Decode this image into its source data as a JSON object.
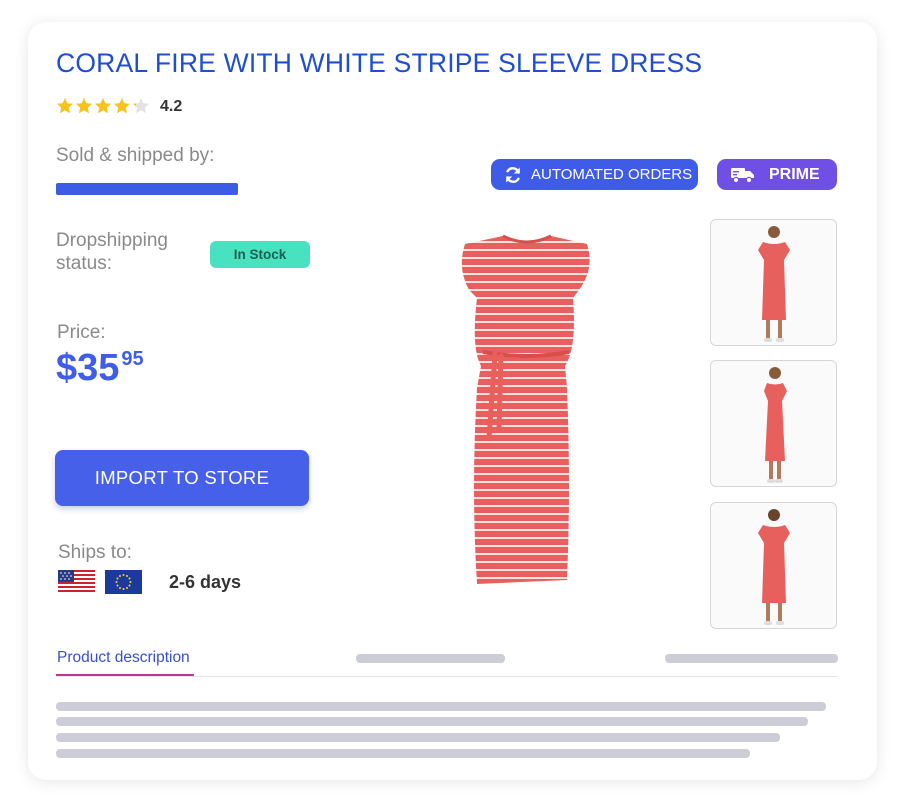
{
  "product": {
    "title": "CORAL FIRE WITH WHITE STRIPE SLEEVE DRESS",
    "rating": {
      "value": "4.2",
      "score": 4.2,
      "max": 5,
      "star_color": "#f8c31b"
    },
    "sold_shipped_label": "Sold & shipped by:",
    "dropshipping_label_line1": "Dropshipping",
    "dropshipping_label_line2": "status:",
    "stock_badge": "In Stock",
    "price_label": "Price:",
    "price_main": "$35",
    "price_cents": "95",
    "import_button": "IMPORT TO STORE",
    "ships_to_label": "Ships to:",
    "ships_to_flags": [
      "us-flag",
      "eu-flag"
    ],
    "delivery_time": "2-6 days"
  },
  "badges": {
    "automated_orders": "AUTOMATED ORDERS",
    "prime": "PRIME"
  },
  "tabs": {
    "active": "Product description"
  },
  "colors": {
    "title": "#1f4fd1",
    "accent": "#4760ea",
    "prime": "#6f4fe6",
    "stock": "#49e2c0",
    "dress": "#e8605e",
    "tab_underline": "#c0339b"
  }
}
